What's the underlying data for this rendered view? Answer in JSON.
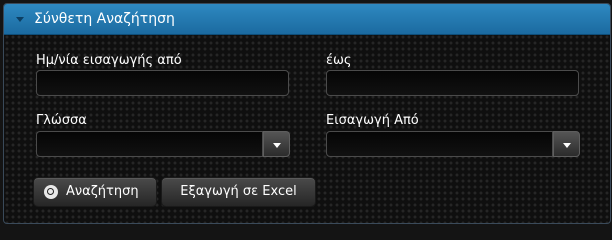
{
  "panel": {
    "title": "Σύνθετη Αναζήτηση",
    "toggle_icon": "triangle-down-icon"
  },
  "form": {
    "date_from_label": "Ημ/νία εισαγωγής από",
    "date_from_value": "",
    "date_to_label": "έως",
    "date_to_value": "",
    "language_label": "Γλώσσα",
    "language_value": "",
    "imported_from_label": "Εισαγωγή Από",
    "imported_from_value": ""
  },
  "actions": {
    "search_label": "Αναζήτηση",
    "search_icon": "search-icon",
    "export_label": "Εξαγωγή σε Excel"
  },
  "colors": {
    "header": "#1f74ad",
    "background": "#141414",
    "text": "#ffffff"
  }
}
